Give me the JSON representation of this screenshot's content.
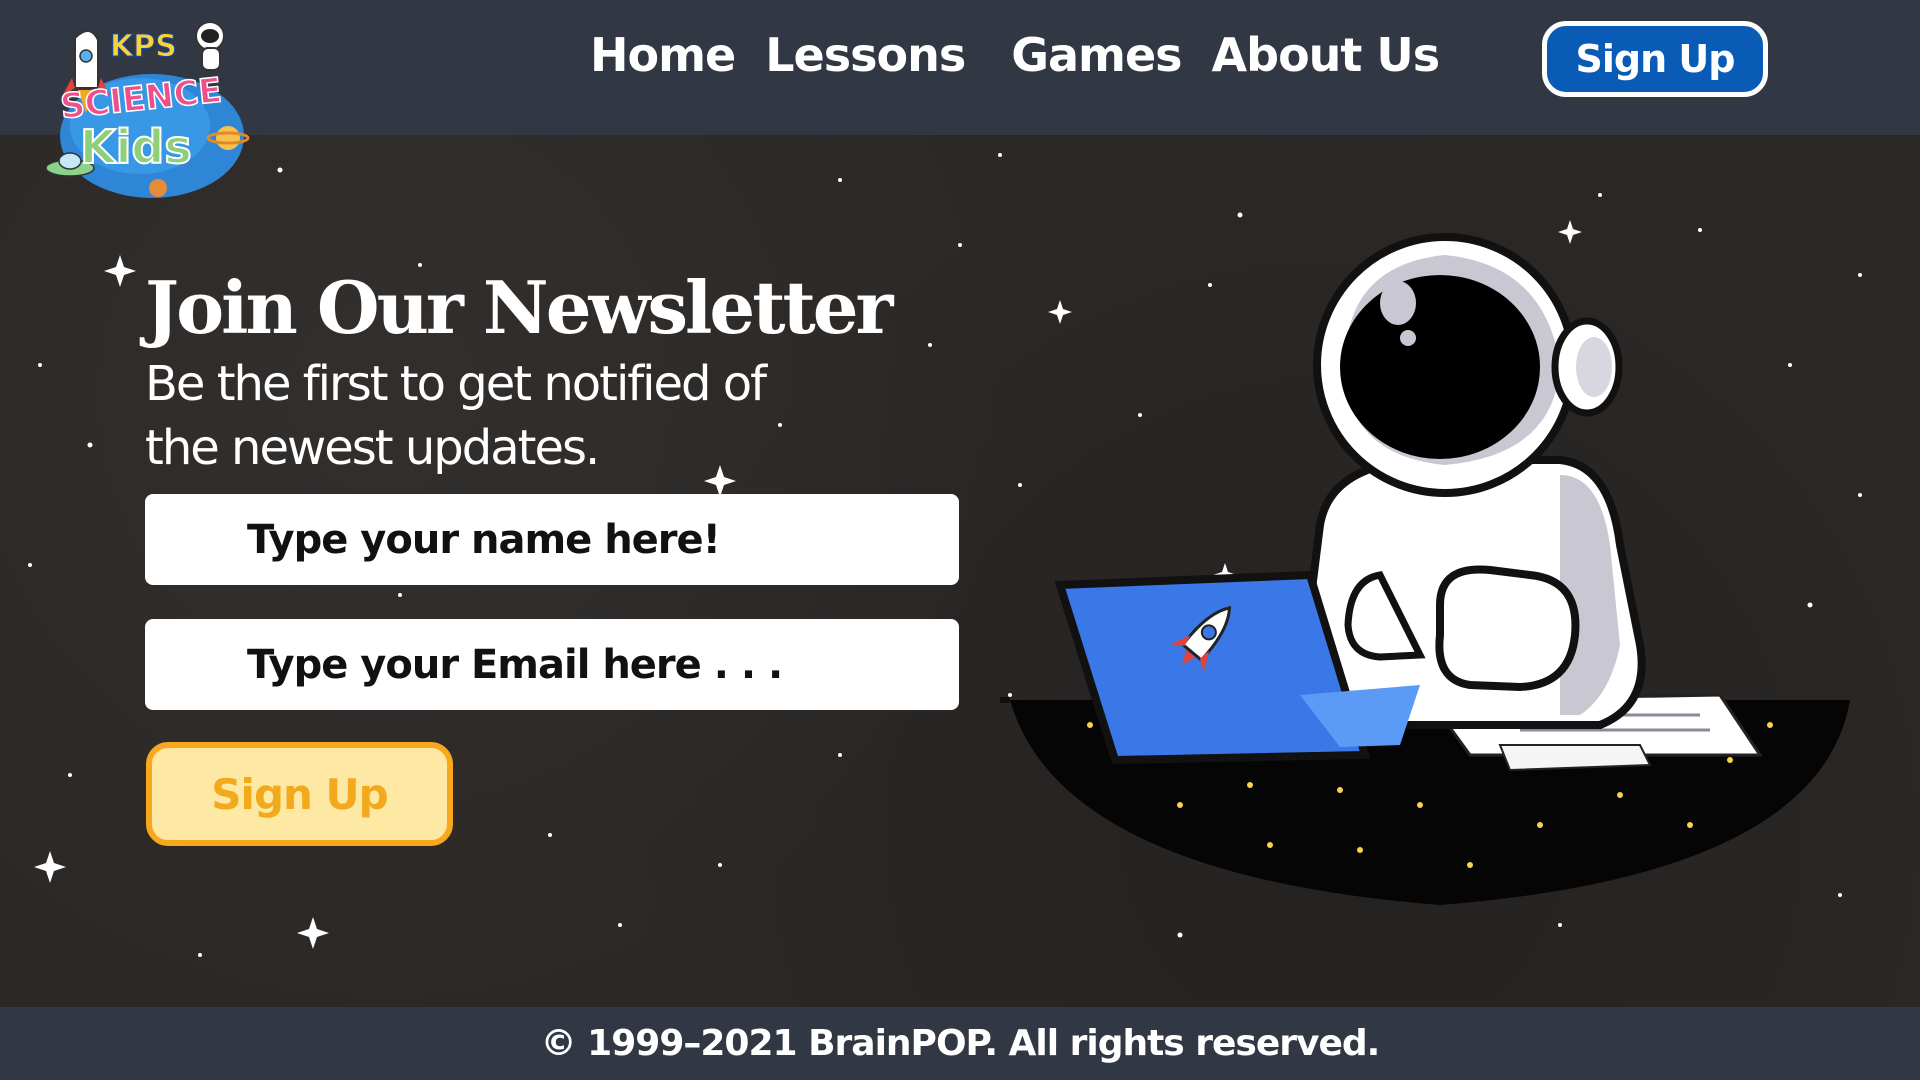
{
  "header": {
    "logo_text": {
      "line1": "KPS",
      "line2": "SCIENCE",
      "line3": "Kids"
    },
    "nav": [
      {
        "label": "Home"
      },
      {
        "label": "Lessons"
      },
      {
        "label": "Games"
      },
      {
        "label": "About Us"
      }
    ],
    "signup_label": "Sign Up"
  },
  "newsletter": {
    "title": "Join Our Newsletter",
    "subtitle_line1": "Be the first to get notified of",
    "subtitle_line2": "the newest updates.",
    "name_placeholder": "Type your name here!",
    "email_placeholder": "Type your Email here . . .",
    "signup_label": "Sign Up"
  },
  "illustration": {
    "icon": "astronaut-with-laptop-icon"
  },
  "footer": {
    "copyright": "© 1999–2021 BrainPOP. All rights reserved."
  },
  "colors": {
    "header_bg": "#313844",
    "main_bg": "#2b2826",
    "top_button": "#0a5bb5",
    "newsletter_button_bg": "#fde8a4",
    "newsletter_button_border": "#f7a81e",
    "laptop": "#3b78e7"
  }
}
